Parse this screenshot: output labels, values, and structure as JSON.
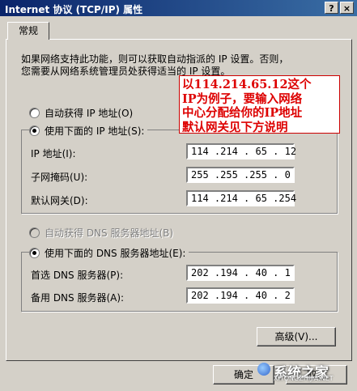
{
  "window": {
    "title": "Internet 协议 (TCP/IP) 属性",
    "help_btn": "?",
    "close_btn": "×"
  },
  "tab": {
    "label": "常规"
  },
  "description": {
    "line1": "如果网络支持此功能，则可以获取自动指派的 IP 设置。否则，",
    "line2": "您需要从网络系统管理员处获得适当的 IP 设置。"
  },
  "annotation": {
    "lines": [
      "以114.214.65.12这个",
      "IP为例子，要输入网络",
      "中心分配给你的IP地址",
      "默认网关见下方说明"
    ]
  },
  "ip_section": {
    "auto_label": "自动获得 IP 地址(O)",
    "manual_label": "使用下面的 IP 地址(S):",
    "fields": [
      {
        "label": "IP 地址(I):",
        "value": "114 .214 . 65 . 12"
      },
      {
        "label": "子网掩码(U):",
        "value": "255 .255 .255 . 0"
      },
      {
        "label": "默认网关(D):",
        "value": "114 .214 . 65 .254"
      }
    ]
  },
  "dns_section": {
    "auto_label": "自动获得 DNS 服务器地址(B)",
    "manual_label": "使用下面的 DNS 服务器地址(E):",
    "fields": [
      {
        "label": "首选 DNS 服务器(P):",
        "value": "202 .194 . 40 . 1"
      },
      {
        "label": "备用 DNS 服务器(A):",
        "value": "202 .194 . 40 . 2"
      }
    ]
  },
  "buttons": {
    "advanced": "高级(V)...",
    "ok": "确定",
    "cancel": "取消"
  },
  "watermark": {
    "main": "系统之家",
    "sub": "XITONGZHIJIA.NET"
  }
}
